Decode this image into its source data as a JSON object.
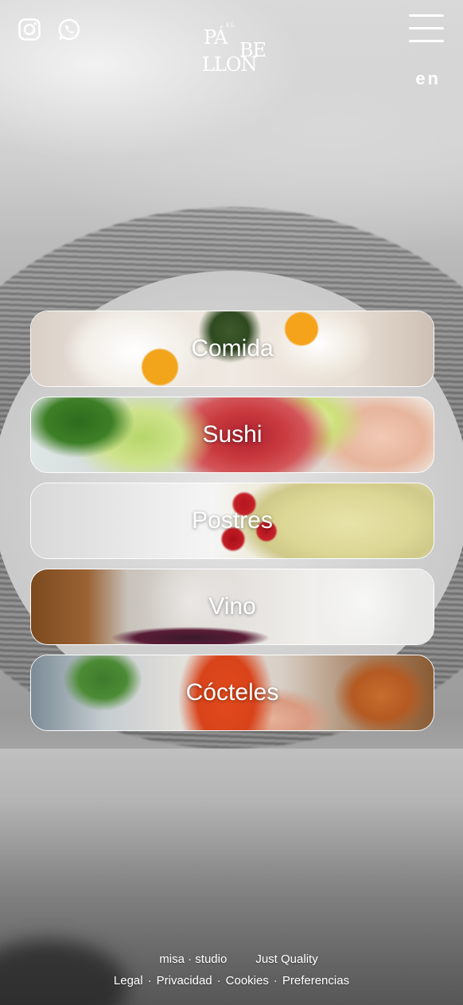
{
  "header": {
    "logo": {
      "top": "EL",
      "line1": "PÁ",
      "line2": "BE",
      "line3": "LLON"
    },
    "social": [
      "instagram-icon",
      "whatsapp-icon"
    ],
    "menu_icon": "hamburger-icon",
    "language": "en"
  },
  "categories": [
    {
      "label": "Comida"
    },
    {
      "label": "Sushi"
    },
    {
      "label": "Postres"
    },
    {
      "label": "Vino"
    },
    {
      "label": "Cócteles"
    }
  ],
  "footer": {
    "credits": [
      "misa · studio",
      "Just Quality"
    ],
    "links": [
      "Legal",
      "Privacidad",
      "Cookies",
      "Preferencias"
    ],
    "separator": "·"
  },
  "colors": {
    "text": "#ffffff",
    "card_border": "#ffffff"
  }
}
